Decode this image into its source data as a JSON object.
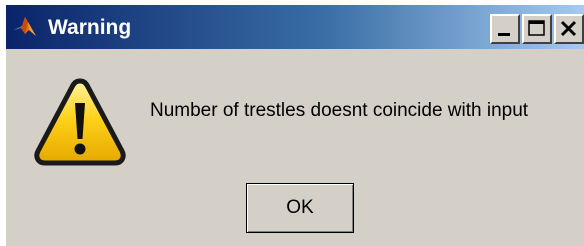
{
  "window": {
    "title": "Warning",
    "app_icon": "matlab-logo-icon",
    "controls": {
      "minimize_icon": "minimize-icon",
      "maximize_icon": "maximize-icon",
      "close_icon": "close-icon"
    }
  },
  "dialog": {
    "icon": "warning-triangle-icon",
    "message": "Number of trestles doesnt coincide with input",
    "ok_label": "OK"
  },
  "colors": {
    "titlebar_start": "#0a246a",
    "titlebar_end": "#a6caf0",
    "face": "#d4d0c8",
    "warning_yellow": "#ffd700"
  }
}
